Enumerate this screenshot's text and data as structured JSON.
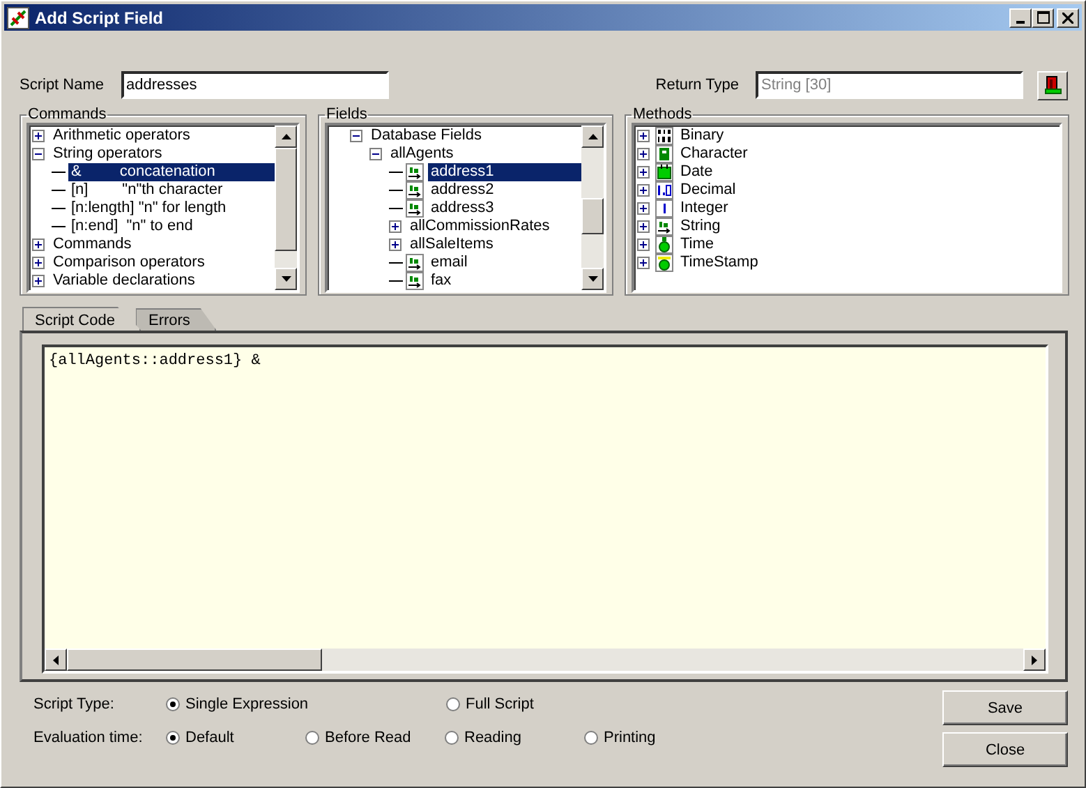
{
  "window": {
    "title": "Add Script Field"
  },
  "script_name": {
    "label": "Script Name",
    "value": "addresses"
  },
  "return_type": {
    "label": "Return Type",
    "value": "String [30]"
  },
  "commands": {
    "label": "Commands",
    "items": [
      {
        "label": "Arithmetic operators",
        "expanded": false,
        "selected": false
      },
      {
        "label": "String operators",
        "expanded": true,
        "selected": false,
        "children": [
          {
            "label": "&         concatenation",
            "selected": true
          },
          {
            "label": "[n]        \"n\"th character",
            "selected": false
          },
          {
            "label": "[n:length] \"n\" for length",
            "selected": false
          },
          {
            "label": "[n:end]  \"n\" to end",
            "selected": false
          }
        ]
      },
      {
        "label": "Commands",
        "expanded": false,
        "selected": false
      },
      {
        "label": "Comparison operators",
        "expanded": false,
        "selected": false
      },
      {
        "label": "Variable declarations",
        "expanded": false,
        "selected": false
      }
    ]
  },
  "fields": {
    "label": "Fields",
    "items": [
      {
        "label": "Database Fields",
        "expanded": true,
        "selected": false,
        "children": [
          {
            "label": "allAgents",
            "expanded": true,
            "selected": false,
            "children": [
              {
                "label": "address1",
                "kind": "string",
                "selected": true
              },
              {
                "label": "address2",
                "kind": "string",
                "selected": false
              },
              {
                "label": "address3",
                "kind": "string",
                "selected": false
              },
              {
                "label": "allCommissionRates",
                "expanded": false,
                "selected": false
              },
              {
                "label": "allSaleItems",
                "expanded": false,
                "selected": false
              },
              {
                "label": "email",
                "kind": "string",
                "selected": false
              },
              {
                "label": "fax",
                "kind": "string",
                "selected": false
              }
            ]
          }
        ]
      }
    ]
  },
  "methods": {
    "label": "Methods",
    "items": [
      {
        "label": "Binary",
        "kind": "binary",
        "expanded": false,
        "selected": false
      },
      {
        "label": "Character",
        "kind": "character",
        "expanded": false,
        "selected": false
      },
      {
        "label": "Date",
        "kind": "date",
        "expanded": false,
        "selected": false
      },
      {
        "label": "Decimal",
        "kind": "decimal",
        "expanded": false,
        "selected": false
      },
      {
        "label": "Integer",
        "kind": "integer",
        "expanded": false,
        "selected": false
      },
      {
        "label": "String",
        "kind": "string",
        "expanded": false,
        "selected": false
      },
      {
        "label": "Time",
        "kind": "time",
        "expanded": false,
        "selected": false
      },
      {
        "label": "TimeStamp",
        "kind": "timestamp",
        "expanded": false,
        "selected": false
      }
    ]
  },
  "tabs": [
    {
      "label": "Script Code",
      "selected": true
    },
    {
      "label": "Errors",
      "selected": false
    }
  ],
  "code": "{allAgents::address1} &",
  "script_type": {
    "label": "Script Type:",
    "options": [
      {
        "label": "Single Expression",
        "selected": true
      },
      {
        "label": "Full Script",
        "selected": false
      }
    ]
  },
  "evaluation_time": {
    "label": "Evaluation time:",
    "options": [
      {
        "label": "Default",
        "selected": true
      },
      {
        "label": "Before Read",
        "selected": false
      },
      {
        "label": "Reading",
        "selected": false
      },
      {
        "label": "Printing",
        "selected": false
      }
    ]
  },
  "buttons": [
    "Save",
    "Close"
  ]
}
